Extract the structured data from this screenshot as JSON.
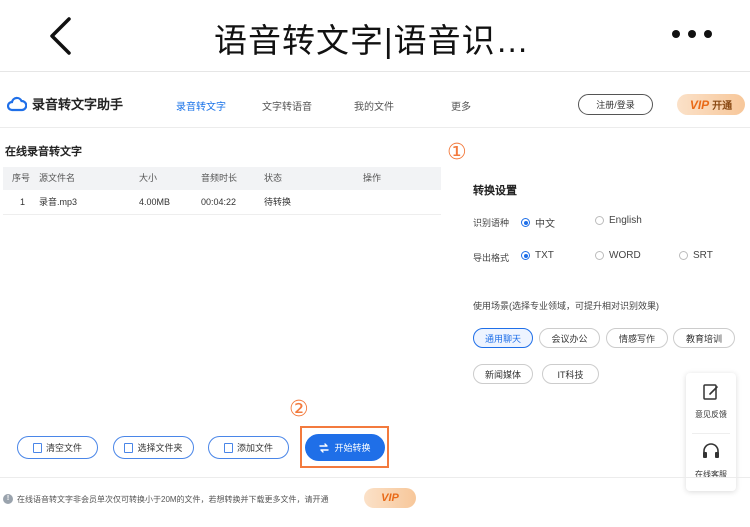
{
  "mobile": {
    "title": "语音转文字|语音识…"
  },
  "nav": {
    "logo_text": "录音转文字助手",
    "items": [
      {
        "label": "录音转文字"
      },
      {
        "label": "文字转语音"
      },
      {
        "label": "我的文件"
      },
      {
        "label": "更多"
      }
    ],
    "login_label": "注册/登录",
    "vip_badge": "VIP",
    "vip_label": "开通"
  },
  "main": {
    "section_title": "在线录音转文字",
    "table": {
      "headers": [
        "序号",
        "源文件名",
        "大小",
        "音频时长",
        "状态",
        "操作"
      ],
      "rows": [
        {
          "index": "1",
          "name": "录音.mp3",
          "size": "4.00MB",
          "duration": "00:04:22",
          "status": "待转换",
          "action": ""
        }
      ]
    },
    "buttons": {
      "clear": "清空文件",
      "select_folder": "选择文件夹",
      "add_file": "添加文件",
      "start": "开始转换"
    },
    "marker_1": "①",
    "marker_2": "②"
  },
  "settings": {
    "title": "转换设置",
    "language_label": "识别语种",
    "languages": [
      {
        "label": "中文",
        "selected": true
      },
      {
        "label": "English",
        "selected": false
      }
    ],
    "format_label": "导出格式",
    "formats": [
      {
        "label": "TXT",
        "selected": true
      },
      {
        "label": "WORD",
        "selected": false
      },
      {
        "label": "SRT",
        "selected": false
      }
    ],
    "scene_hint": "使用场景(选择专业领域，可提升相对识别效果)",
    "scenes": [
      {
        "label": "通用聊天",
        "selected": true
      },
      {
        "label": "会议办公",
        "selected": false
      },
      {
        "label": "情感写作",
        "selected": false
      },
      {
        "label": "教育培训",
        "selected": false
      },
      {
        "label": "新闻媒体",
        "selected": false
      },
      {
        "label": "IT科技",
        "selected": false
      }
    ]
  },
  "float": {
    "feedback": "意见反馈",
    "service": "在线客服"
  },
  "notice": {
    "text": "在线语音转文字非会员单次仅可转换小于20M的文件，若想转换并下载更多文件，请开通",
    "vip": "VIP"
  },
  "colors": {
    "accent": "#1f6fe8",
    "highlight": "#f37a3d",
    "vip_text": "#e96a18"
  }
}
